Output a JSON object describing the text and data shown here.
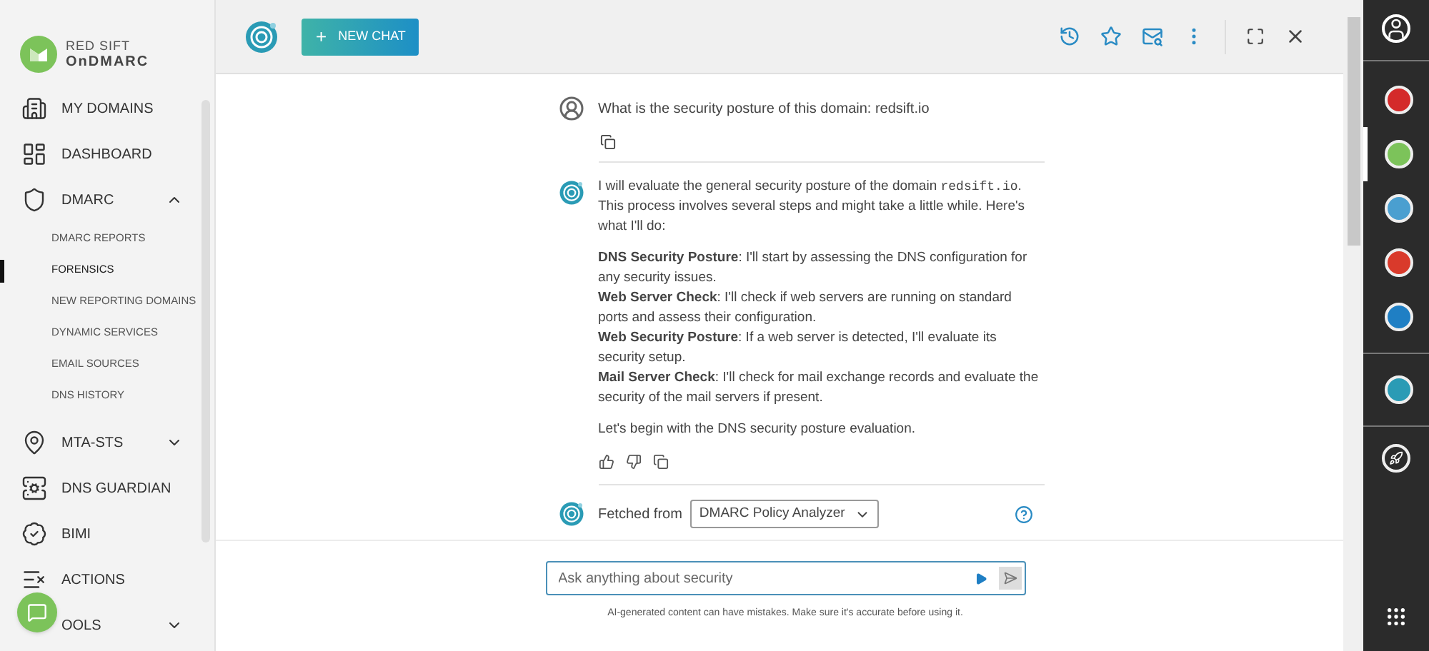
{
  "brand": {
    "line1": "RED SIFT",
    "line2": "OnDMARC"
  },
  "sidebar": {
    "items": [
      {
        "label": "MY DOMAINS"
      },
      {
        "label": "DASHBOARD"
      },
      {
        "label": "DMARC",
        "expanded": true,
        "children": [
          {
            "label": "DMARC REPORTS",
            "selected": false
          },
          {
            "label": "FORENSICS",
            "selected": true
          },
          {
            "label": "NEW REPORTING DOMAINS",
            "selected": false
          },
          {
            "label": "DYNAMIC SERVICES",
            "selected": false
          },
          {
            "label": "EMAIL SOURCES",
            "selected": false
          },
          {
            "label": "DNS HISTORY",
            "selected": false
          }
        ]
      },
      {
        "label": "MTA-STS",
        "expanded": false
      },
      {
        "label": "DNS GUARDIAN"
      },
      {
        "label": "BIMI"
      },
      {
        "label": "ACTIONS"
      },
      {
        "label": "OOLS",
        "expanded": false
      }
    ]
  },
  "header": {
    "new_chat": "NEW CHAT",
    "new_chat_icon": "+"
  },
  "chat": {
    "question": "What is the security posture of this domain: redsift.io",
    "answer": {
      "before": "I will evaluate the general security posture of the domain ",
      "code": "redsift.io",
      "after": ". This process involves several steps and might take a little while. Here's what I'll do:",
      "steps": [
        "**DNS Security Posture**: I'll start by assessing the DNS configuration for any security issues.",
        "**Web Server Check**: I'll check if web servers are running on standard ports and assess their configuration.",
        "**Web Security Posture**: If a web server is detected, I'll evaluate its security setup.",
        "**Mail Server Check**: I'll check for mail exchange records and evaluate the security of the mail servers if present."
      ],
      "closing": "Let's begin with the DNS security posture evaluation."
    },
    "fetched_label": "Fetched from",
    "source": "DMARC Policy Analyzer"
  },
  "input": {
    "placeholder": "Ask anything about security"
  },
  "disclaimer": "AI-generated content can have mistakes. Make sure it's accurate before using it.",
  "rail": {
    "groups": [
      [
        {
          "color": "#d42a2a",
          "selected": false
        },
        {
          "color": "#7cc35a",
          "selected": true
        },
        {
          "color": "#4a9fd0",
          "selected": false
        },
        {
          "color": "#d93a2b",
          "selected": false
        },
        {
          "color": "#1f7fc4",
          "selected": false
        }
      ],
      [
        {
          "color": "#2a9bb5",
          "selected": false
        }
      ]
    ]
  }
}
